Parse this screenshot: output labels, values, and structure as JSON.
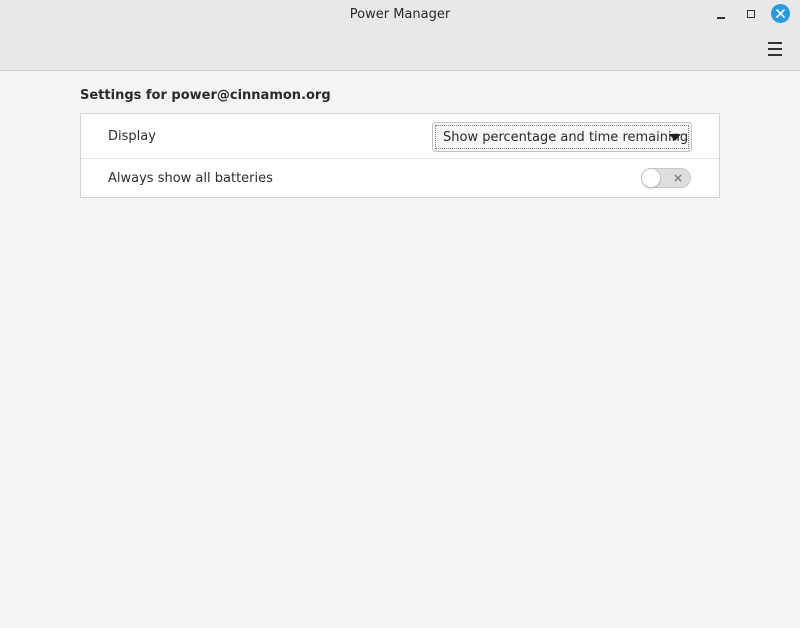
{
  "window": {
    "title": "Power Manager",
    "close_color": "#2d9ad9"
  },
  "header": {
    "menu_icon": "hamburger-menu-icon",
    "minimize_icon": "minimize-icon",
    "maximize_icon": "maximize-icon",
    "close_icon": "close-icon"
  },
  "section": {
    "title": "Settings for power@cinnamon.org"
  },
  "settings": {
    "display": {
      "label": "Display",
      "selected": "Show percentage and time remaining"
    },
    "batteries": {
      "label": "Always show all batteries",
      "toggle_state": "off",
      "toggle_mark": "×"
    }
  }
}
